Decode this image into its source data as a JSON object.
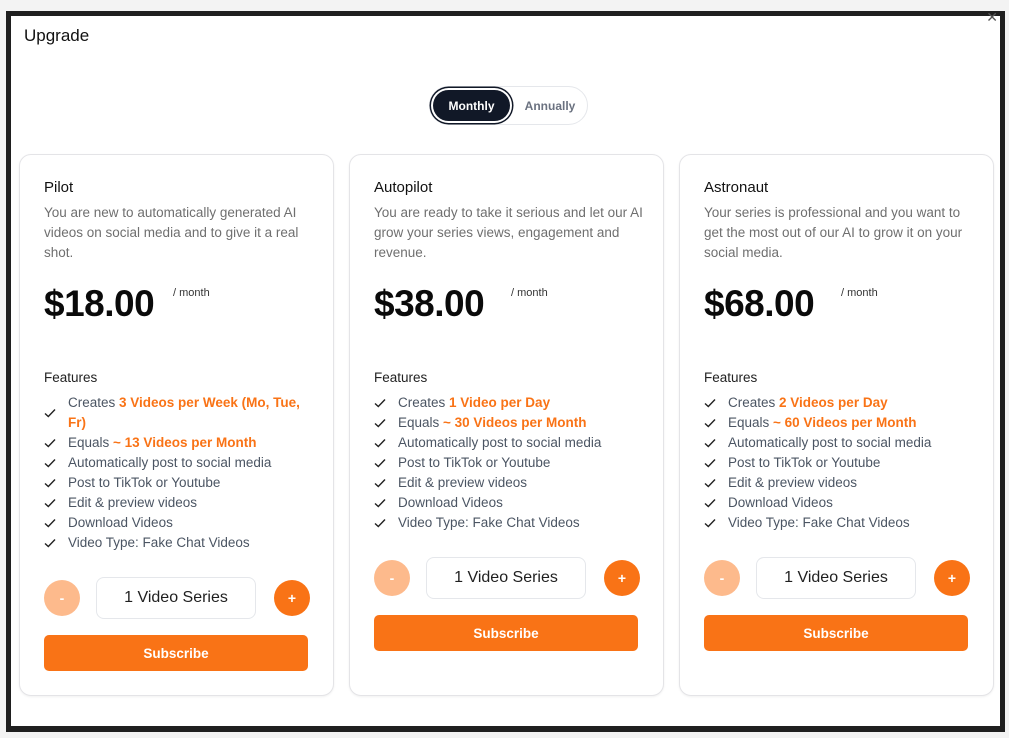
{
  "modal": {
    "title": "Upgrade",
    "close_icon": "close-icon"
  },
  "billing_toggle": {
    "options": [
      "Monthly",
      "Annually"
    ],
    "selected": "Monthly"
  },
  "colors": {
    "accent": "#f97316",
    "accent_light": "#fdba8c",
    "toggle_active": "#111827"
  },
  "plans": [
    {
      "name": "Pilot",
      "description": "You are new to automatically generated AI videos on social media and to give it a real shot.",
      "price": "$18.00",
      "period": "/ month",
      "features_title": "Features",
      "features": [
        {
          "prefix": "Creates ",
          "highlight": "3 Videos per Week (Mo, Tue, Fr)"
        },
        {
          "prefix": "Equals ",
          "highlight": "~ 13 Videos per Month"
        },
        {
          "prefix": "Automatically post to social media",
          "highlight": ""
        },
        {
          "prefix": "Post to TikTok or Youtube",
          "highlight": ""
        },
        {
          "prefix": "Edit & preview videos",
          "highlight": ""
        },
        {
          "prefix": "Download Videos",
          "highlight": ""
        },
        {
          "prefix": "Video Type: Fake Chat Videos",
          "highlight": ""
        }
      ],
      "quantity_label": "1 Video Series",
      "minus_label": "-",
      "plus_label": "+",
      "subscribe_label": "Subscribe"
    },
    {
      "name": "Autopilot",
      "description": "You are ready to take it serious and let our AI grow your series views, engagement and revenue.",
      "price": "$38.00",
      "period": "/ month",
      "features_title": "Features",
      "features": [
        {
          "prefix": "Creates ",
          "highlight": "1 Video per Day"
        },
        {
          "prefix": "Equals ",
          "highlight": "~ 30 Videos per Month"
        },
        {
          "prefix": "Automatically post to social media",
          "highlight": ""
        },
        {
          "prefix": "Post to TikTok or Youtube",
          "highlight": ""
        },
        {
          "prefix": "Edit & preview videos",
          "highlight": ""
        },
        {
          "prefix": "Download Videos",
          "highlight": ""
        },
        {
          "prefix": "Video Type: Fake Chat Videos",
          "highlight": ""
        }
      ],
      "quantity_label": "1 Video Series",
      "minus_label": "-",
      "plus_label": "+",
      "subscribe_label": "Subscribe"
    },
    {
      "name": "Astronaut",
      "description": "Your series is professional and you want to get the most out of our AI to grow it on your social media.",
      "price": "$68.00",
      "period": "/ month",
      "features_title": "Features",
      "features": [
        {
          "prefix": "Creates ",
          "highlight": "2 Videos per Day"
        },
        {
          "prefix": "Equals ",
          "highlight": "~ 60 Videos per Month"
        },
        {
          "prefix": "Automatically post to social media",
          "highlight": ""
        },
        {
          "prefix": "Post to TikTok or Youtube",
          "highlight": ""
        },
        {
          "prefix": "Edit & preview videos",
          "highlight": ""
        },
        {
          "prefix": "Download Videos",
          "highlight": ""
        },
        {
          "prefix": "Video Type: Fake Chat Videos",
          "highlight": ""
        }
      ],
      "quantity_label": "1 Video Series",
      "minus_label": "-",
      "plus_label": "+",
      "subscribe_label": "Subscribe"
    }
  ]
}
